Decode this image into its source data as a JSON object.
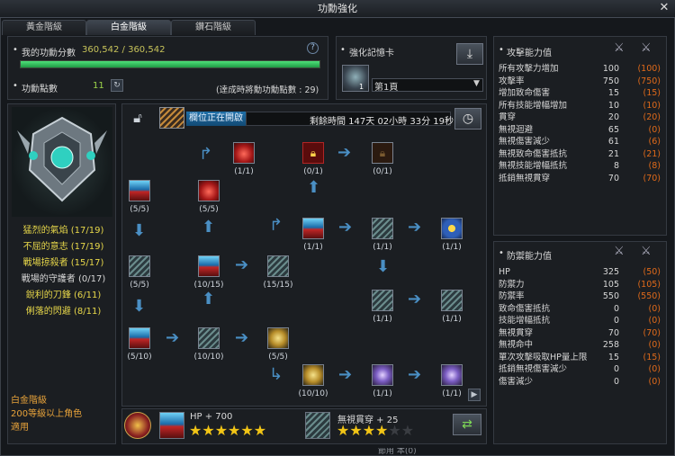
{
  "window": {
    "title": "功勳強化",
    "close": "✕"
  },
  "tabs": [
    {
      "label": "黃金階級"
    },
    {
      "label": "白金階級"
    },
    {
      "label": "鑽石階級"
    }
  ],
  "score": {
    "label": "我的功勳分數",
    "value": "360,542 / 360,542",
    "progress": 1.0
  },
  "points": {
    "label": "功勳點數",
    "value": "11",
    "note": "(達成時將勳功勳點數 : 29)",
    "help": "?"
  },
  "card": {
    "label": "強化記憶卡",
    "slot_num": "1",
    "page": "第1頁"
  },
  "status": {
    "open_label": "欄位正在開啟",
    "remaining": "剩餘時間 147天 02小時 33分 19秒"
  },
  "sidebar": {
    "items": [
      {
        "label": "猛烈的氣焰 (17/19)",
        "color": "#e8d84a"
      },
      {
        "label": "不屈的意志 (17/19)",
        "color": "#e8d84a"
      },
      {
        "label": "戰場掠殺者 (15/17)",
        "color": "#e8d84a"
      },
      {
        "label": "戰場的守護者 (0/17)",
        "color": "#d9d9d9"
      },
      {
        "label": "銳利的刀鋒 (6/11)",
        "color": "#e8d84a"
      },
      {
        "label": "俐落的閃避 (8/11)",
        "color": "#e8d84a"
      }
    ],
    "rank_info": [
      "白金階級",
      "200等級以上角色",
      "適用"
    ]
  },
  "nodes": [
    {
      "count": "(1/1)"
    },
    {
      "count": "(0/1)"
    },
    {
      "count": "(0/1)"
    },
    {
      "count": "(5/5)"
    },
    {
      "count": "(5/5)"
    },
    {
      "count": "(1/1)"
    },
    {
      "count": "(1/1)"
    },
    {
      "count": "(1/1)"
    },
    {
      "count": "(5/5)"
    },
    {
      "count": "(10/15)"
    },
    {
      "count": "(15/15)"
    },
    {
      "count": "(1/1)"
    },
    {
      "count": "(1/1)"
    },
    {
      "count": "(1/1)"
    },
    {
      "count": "(5/10)"
    },
    {
      "count": "(10/10)"
    },
    {
      "count": "(5/5)"
    },
    {
      "count": "(10/10)"
    },
    {
      "count": "(1/1)"
    },
    {
      "count": "(1/1)"
    },
    {
      "count": "(1/1)"
    }
  ],
  "bottom": {
    "stat1": "HP + 700",
    "stars1": 6,
    "stat2": "無視貫穿 + 25",
    "stars2": 4,
    "stars2_max": 6,
    "footer_partial": "節用 本(0)"
  },
  "attack": {
    "title": "攻擊能力值",
    "rows": [
      {
        "name": "所有攻擊力增加",
        "value": "100",
        "plus": "(100)"
      },
      {
        "name": "攻擊率",
        "value": "750",
        "plus": "(750)"
      },
      {
        "name": "增加致命傷害",
        "value": "15",
        "plus": "(15)"
      },
      {
        "name": "所有技能增幅增加",
        "value": "10",
        "plus": "(10)"
      },
      {
        "name": "貫穿",
        "value": "20",
        "plus": "(20)"
      },
      {
        "name": "無視迴避",
        "value": "65",
        "plus": "(0)"
      },
      {
        "name": "無視傷害減少",
        "value": "61",
        "plus": "(6)"
      },
      {
        "name": "無視致命傷害抵抗",
        "value": "21",
        "plus": "(21)"
      },
      {
        "name": "無視技能增幅抵抗",
        "value": "8",
        "plus": "(8)"
      },
      {
        "name": "抵銷無視貫穿",
        "value": "70",
        "plus": "(70)"
      }
    ]
  },
  "defense": {
    "title": "防禦能力值",
    "rows": [
      {
        "name": "HP",
        "value": "325",
        "plus": "(50)"
      },
      {
        "name": "防禦力",
        "value": "105",
        "plus": "(105)"
      },
      {
        "name": "防禦率",
        "value": "550",
        "plus": "(550)"
      },
      {
        "name": "致命傷害抵抗",
        "value": "0",
        "plus": "(0)"
      },
      {
        "name": "技能增幅抵抗",
        "value": "0",
        "plus": "(0)"
      },
      {
        "name": "無視貫穿",
        "value": "70",
        "plus": "(70)"
      },
      {
        "name": "無視命中",
        "value": "258",
        "plus": "(0)"
      },
      {
        "name": "單次攻擊吸取HP量上限",
        "value": "15",
        "plus": "(15)"
      },
      {
        "name": "抵銷無視傷害減少",
        "value": "0",
        "plus": "(0)"
      },
      {
        "name": "傷害減少",
        "value": "0",
        "plus": "(0)"
      }
    ]
  }
}
